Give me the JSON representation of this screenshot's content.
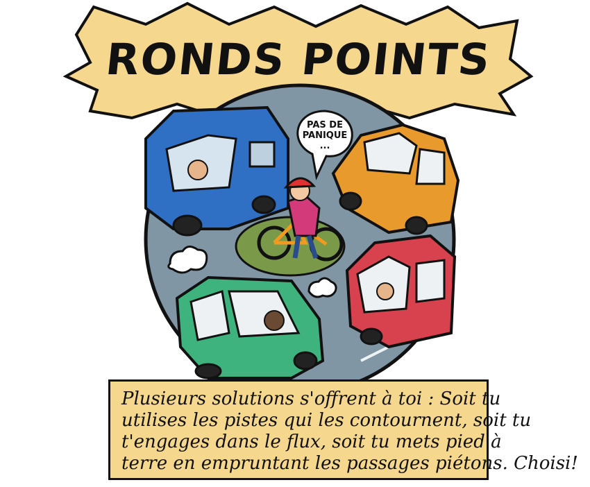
{
  "title": "RONDS POINTS",
  "speech_bubble": {
    "line1": "PAS DE",
    "line2": "PANIQUE",
    "line3": "..."
  },
  "caption": {
    "lines": [
      "Plusieurs solutions s'offrent à toi : Soit tu",
      "utilises les pistes qui les contournent, soit tu",
      "t'engages dans le flux, soit tu mets pied à",
      "terre en empruntant les passages piétons. Choisi!"
    ]
  },
  "colors": {
    "burst": "#f6d78e",
    "road": "#8096a4",
    "island": "#7a9a4a",
    "van": "#2f6fc4",
    "orange_car": "#e99a2c",
    "red_car": "#d8414e",
    "green_car": "#3fb37e",
    "helmet": "#e03030",
    "jacket": "#d23a7a"
  },
  "illustration_elements": [
    "blue-van",
    "orange-car",
    "red-car",
    "green-car",
    "cyclist",
    "roundabout-island",
    "exhaust-clouds"
  ]
}
